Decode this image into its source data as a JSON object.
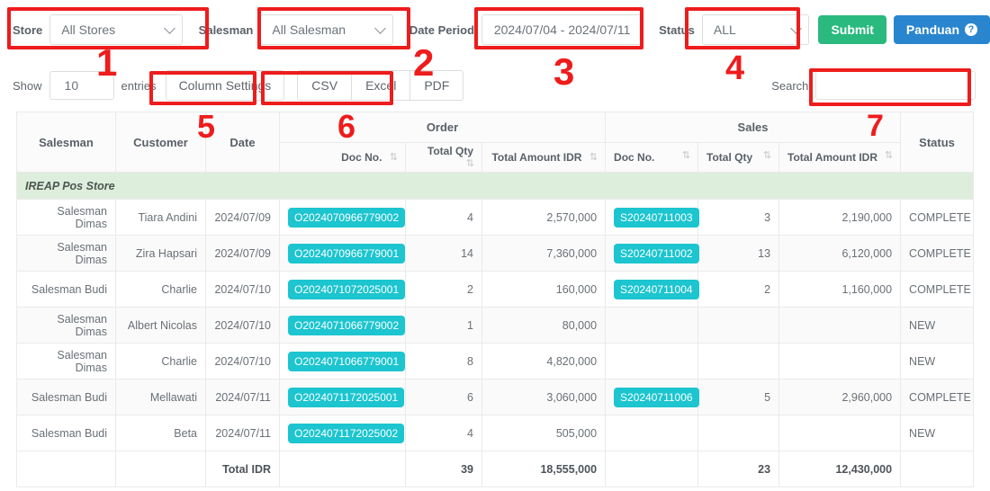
{
  "filters": {
    "store_label": "Store",
    "store_value": "All Stores",
    "salesman_label": "Salesman",
    "salesman_value": "All Salesman",
    "date_label": "Date Period",
    "date_value": "2024/07/04 - 2024/07/11",
    "status_label": "Status",
    "status_value": "ALL",
    "submit_label": "Submit",
    "panduan_label": "Panduan",
    "panduan_icon": "question-circle-icon",
    "submit_color": "#2ab97e",
    "panduan_color": "#2a85cf"
  },
  "toolbar": {
    "show_label": "Show",
    "entries_value": "10",
    "entries_label": "entries",
    "column_settings_label": "Column Settings",
    "exports": [
      "CSV",
      "Excel",
      "PDF"
    ],
    "search_label": "Search:",
    "search_value": "",
    "search_placeholder": ""
  },
  "table": {
    "group_headers": [
      {
        "label": "Salesman",
        "span": 1
      },
      {
        "label": "Customer",
        "span": 1
      },
      {
        "label": "Date",
        "span": 1
      },
      {
        "label": "Order",
        "span": 3
      },
      {
        "label": "Sales",
        "span": 3
      },
      {
        "label": "Status",
        "span": 1
      }
    ],
    "sub_headers": [
      {
        "label": "",
        "align": "r"
      },
      {
        "label": "",
        "align": "r"
      },
      {
        "label": "",
        "align": "r"
      },
      {
        "label": "Doc No.",
        "align": "r"
      },
      {
        "label": "Total Qty",
        "align": "r"
      },
      {
        "label": "Total Amount IDR",
        "align": "r"
      },
      {
        "label": "Doc No.",
        "align": "l"
      },
      {
        "label": "Total Qty",
        "align": "l"
      },
      {
        "label": "Total Amount IDR",
        "align": "l"
      },
      {
        "label": "",
        "align": "r"
      }
    ],
    "sort_icon": "sort-updown-icon",
    "group_row_label": "IREAP Pos Store",
    "group_row_color": "#ddeedd",
    "badge_color": "#1cc5cf",
    "rows": [
      {
        "salesman": "Salesman Dimas",
        "customer": "Tiara Andini",
        "date": "2024/07/09",
        "order_doc": "O2024070966779002",
        "order_qty": "4",
        "order_amount": "2,570,000",
        "sales_doc": "S20240711003",
        "sales_qty": "3",
        "sales_amount": "2,190,000",
        "status": "COMPLETE"
      },
      {
        "salesman": "Salesman Dimas",
        "customer": "Zira Hapsari",
        "date": "2024/07/09",
        "order_doc": "O2024070966779001",
        "order_qty": "14",
        "order_amount": "7,360,000",
        "sales_doc": "S20240711002",
        "sales_qty": "13",
        "sales_amount": "6,120,000",
        "status": "COMPLETE"
      },
      {
        "salesman": "Salesman Budi",
        "customer": "Charlie",
        "date": "2024/07/10",
        "order_doc": "O2024071072025001",
        "order_qty": "2",
        "order_amount": "160,000",
        "sales_doc": "S20240711004",
        "sales_qty": "2",
        "sales_amount": "1,160,000",
        "status": "COMPLETE"
      },
      {
        "salesman": "Salesman Dimas",
        "customer": "Albert Nicolas",
        "date": "2024/07/10",
        "order_doc": "O2024071066779002",
        "order_qty": "1",
        "order_amount": "80,000",
        "sales_doc": "",
        "sales_qty": "",
        "sales_amount": "",
        "status": "NEW"
      },
      {
        "salesman": "Salesman Dimas",
        "customer": "Charlie",
        "date": "2024/07/10",
        "order_doc": "O2024071066779001",
        "order_qty": "8",
        "order_amount": "4,820,000",
        "sales_doc": "",
        "sales_qty": "",
        "sales_amount": "",
        "status": "NEW"
      },
      {
        "salesman": "Salesman Budi",
        "customer": "Mellawati",
        "date": "2024/07/11",
        "order_doc": "O2024071172025001",
        "order_qty": "6",
        "order_amount": "3,060,000",
        "sales_doc": "S20240711006",
        "sales_qty": "5",
        "sales_amount": "2,960,000",
        "status": "COMPLETE"
      },
      {
        "salesman": "Salesman Budi",
        "customer": "Beta",
        "date": "2024/07/11",
        "order_doc": "O2024071172025002",
        "order_qty": "4",
        "order_amount": "505,000",
        "sales_doc": "",
        "sales_qty": "",
        "sales_amount": "",
        "status": "NEW"
      }
    ],
    "total_row": {
      "label": "Total IDR",
      "order_qty": "39",
      "order_amount": "18,555,000",
      "sales_qty": "23",
      "sales_amount": "12,430,000"
    }
  },
  "annotations": {
    "color": "#ee1c1c",
    "numbers": [
      "1",
      "2",
      "3",
      "4",
      "5",
      "6",
      "7"
    ]
  }
}
